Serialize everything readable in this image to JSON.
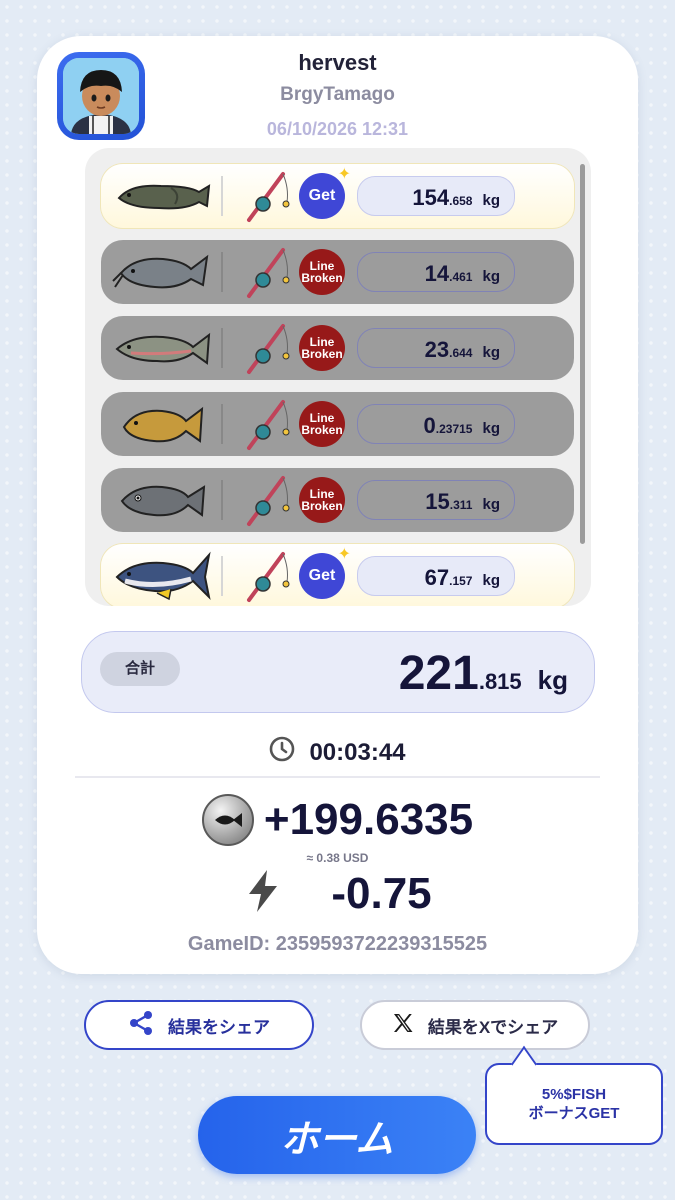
{
  "player": {
    "name": "hervest",
    "handle": "BrgyTamago",
    "datetime": "06/10/2026 12:31"
  },
  "catches": [
    {
      "status": "get",
      "badge": "Get",
      "weight_int": "154",
      "weight_dec": ".658",
      "unit": "kg",
      "fish": "arapaima"
    },
    {
      "status": "broken",
      "badge_line1": "Line",
      "badge_line2": "Broken",
      "weight_int": "14",
      "weight_dec": ".461",
      "unit": "kg",
      "fish": "catfish"
    },
    {
      "status": "broken",
      "badge_line1": "Line",
      "badge_line2": "Broken",
      "weight_int": "23",
      "weight_dec": ".644",
      "unit": "kg",
      "fish": "salmon"
    },
    {
      "status": "broken",
      "badge_line1": "Line",
      "badge_line2": "Broken",
      "weight_int": "0",
      "weight_dec": ".23715",
      "unit": "kg",
      "fish": "carp"
    },
    {
      "status": "broken",
      "badge_line1": "Line",
      "badge_line2": "Broken",
      "weight_int": "15",
      "weight_dec": ".311",
      "unit": "kg",
      "fish": "grouper"
    },
    {
      "status": "get",
      "badge": "Get",
      "weight_int": "67",
      "weight_dec": ".157",
      "unit": "kg",
      "fish": "tuna"
    }
  ],
  "total": {
    "label": "合計",
    "int": "221",
    "dec": ".815",
    "unit": "kg"
  },
  "duration": "00:03:44",
  "reward": {
    "value": "+199.6335",
    "usd": "≈ 0.38 USD"
  },
  "energy": "-0.75",
  "game_id": "GameID: 2359593722239315525",
  "buttons": {
    "share": "結果をシェア",
    "share_x": "結果をXでシェア",
    "home": "ホーム"
  },
  "bonus": {
    "line1": "5%$FISH",
    "line2": "ボーナスGET"
  },
  "colors": {
    "accent": "#3445c9",
    "home_button": "#2563eb",
    "line_broken_badge": "#971919",
    "get_badge": "#3f47d6"
  }
}
